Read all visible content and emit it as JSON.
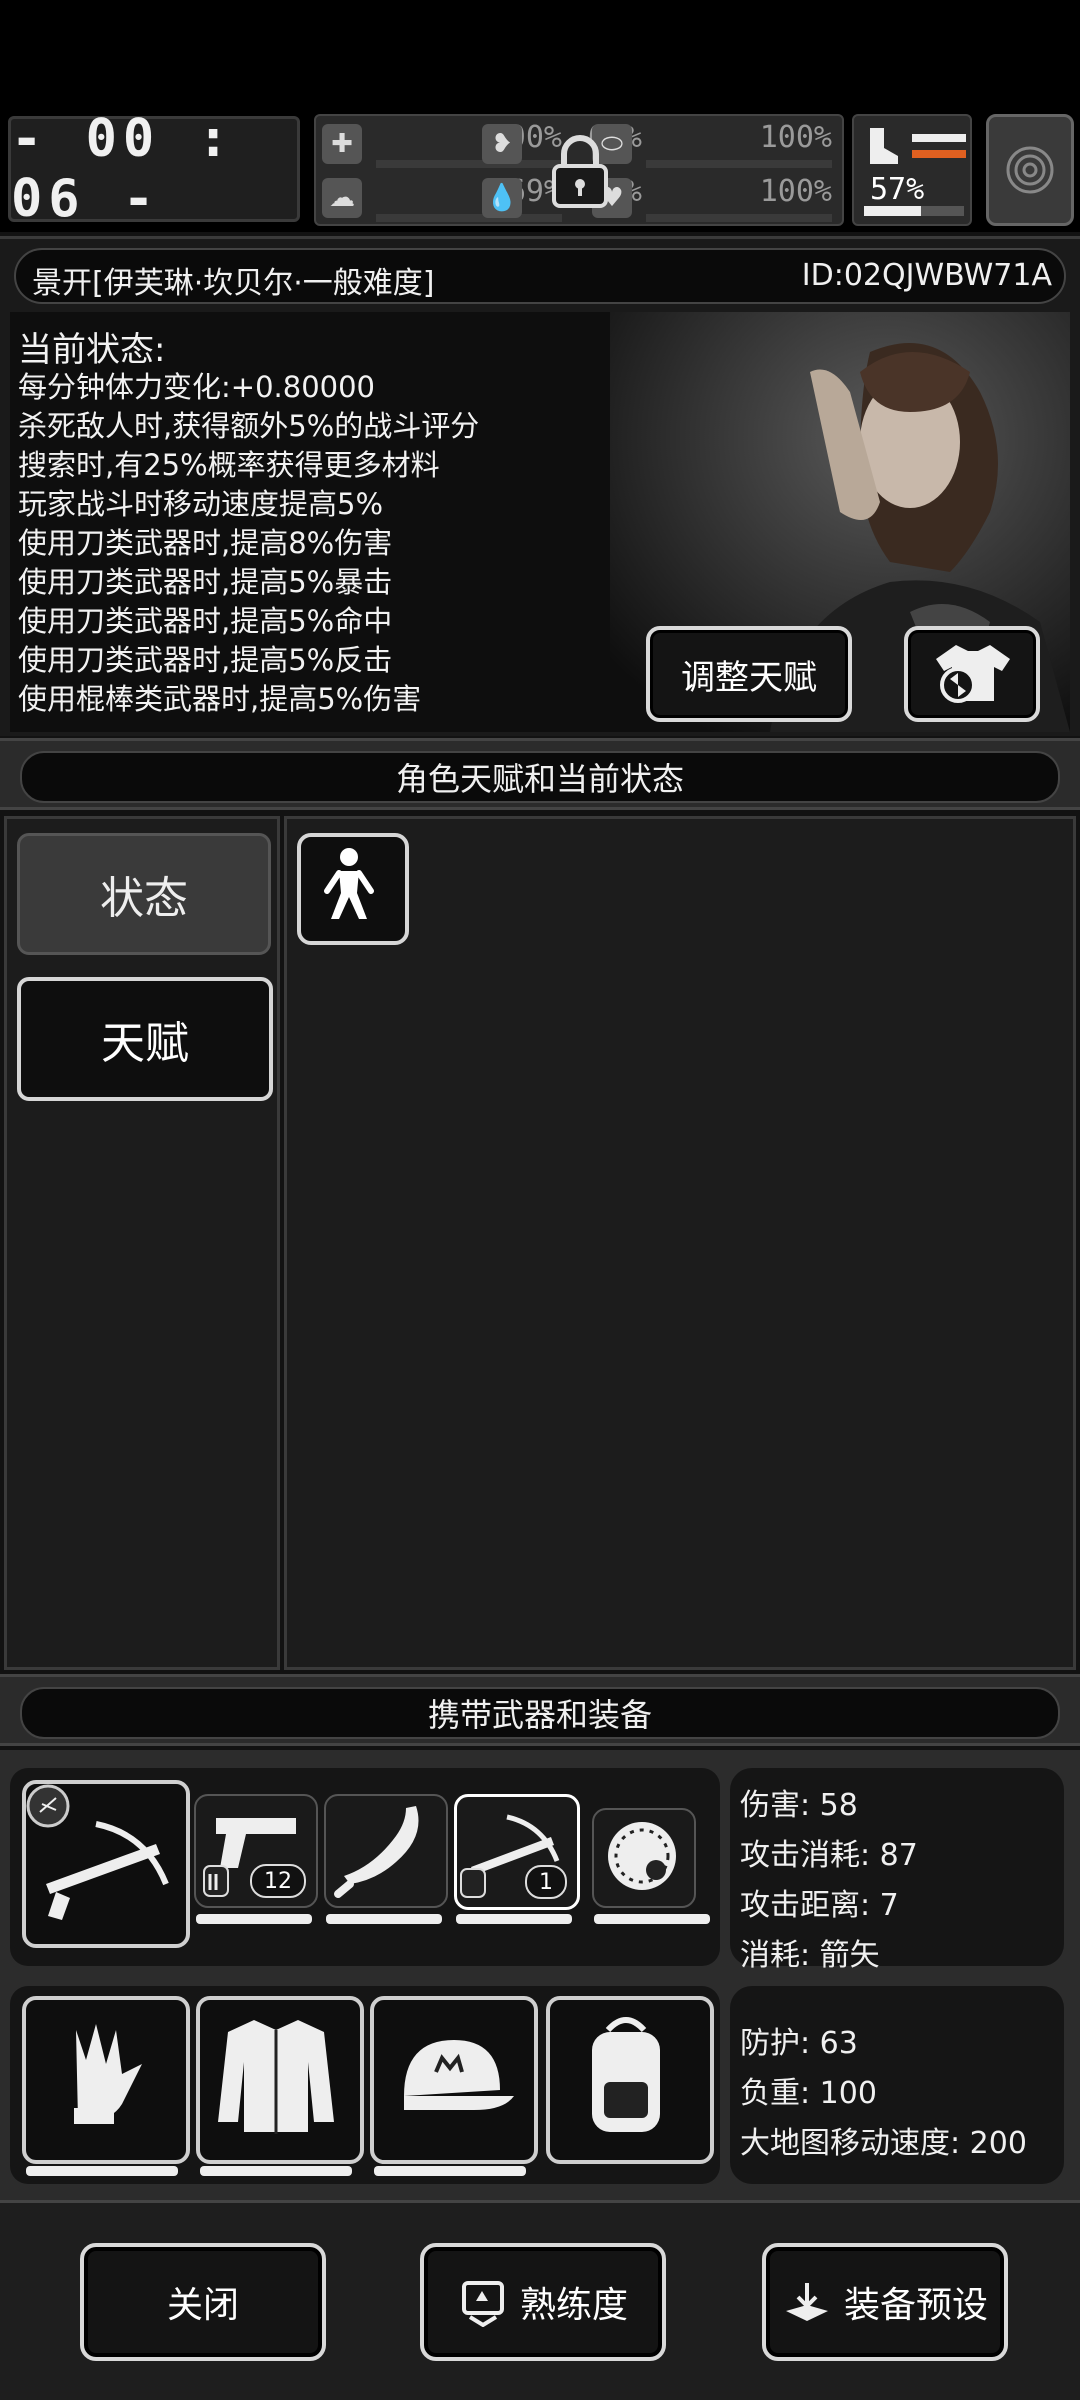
{
  "hud": {
    "timer": "- 00 : 06 -",
    "stats": [
      {
        "icon": "medkit-icon",
        "value": "100%"
      },
      {
        "icon": "stomach-icon",
        "value": "68%"
      },
      {
        "icon": "capsule-icon",
        "value": "100%"
      },
      {
        "icon": "brain-icon",
        "value": "69%"
      },
      {
        "icon": "water-drop-icon",
        "value": "8%"
      },
      {
        "icon": "heart-icon",
        "value": "100%"
      }
    ],
    "stamina": {
      "value": "57%",
      "fill": 0.57
    }
  },
  "character": {
    "name": "景开[伊芙琳·坎贝尔·一般难度]",
    "id": "ID:02QJWBW71A",
    "status_title": "当前状态:",
    "status_lines": [
      "每分钟体力变化:+0.80000",
      "杀死敌人时,获得额外5%的战斗评分",
      "搜索时,有25%概率获得更多材料",
      "玩家战斗时移动速度提高5%",
      "使用刀类武器时,提高8%伤害",
      "使用刀类武器时,提高5%暴击",
      "使用刀类武器时,提高5%命中",
      "使用刀类武器时,提高5%反击",
      "使用棍棒类武器时,提高5%伤害"
    ],
    "adjust_button": "调整天赋"
  },
  "sections": {
    "talents_title": "角色天赋和当前状态",
    "equipment_title": "携带武器和装备"
  },
  "tabs": {
    "status": "状态",
    "talent": "天赋"
  },
  "weapons": {
    "pistol_ammo": "12",
    "crossbow_ammo": "1"
  },
  "weapon_stats": {
    "damage": "伤害: 58",
    "attack_cost": "攻击消耗: 87",
    "attack_range": "攻击距离: 7",
    "consume": "消耗: 箭矢"
  },
  "armor_stats": {
    "defense": "防护: 63",
    "load": "负重: 100",
    "map_speed": "大地图移动速度: 200"
  },
  "footer": {
    "close": "关闭",
    "proficiency": "熟练度",
    "preset": "装备预设"
  }
}
